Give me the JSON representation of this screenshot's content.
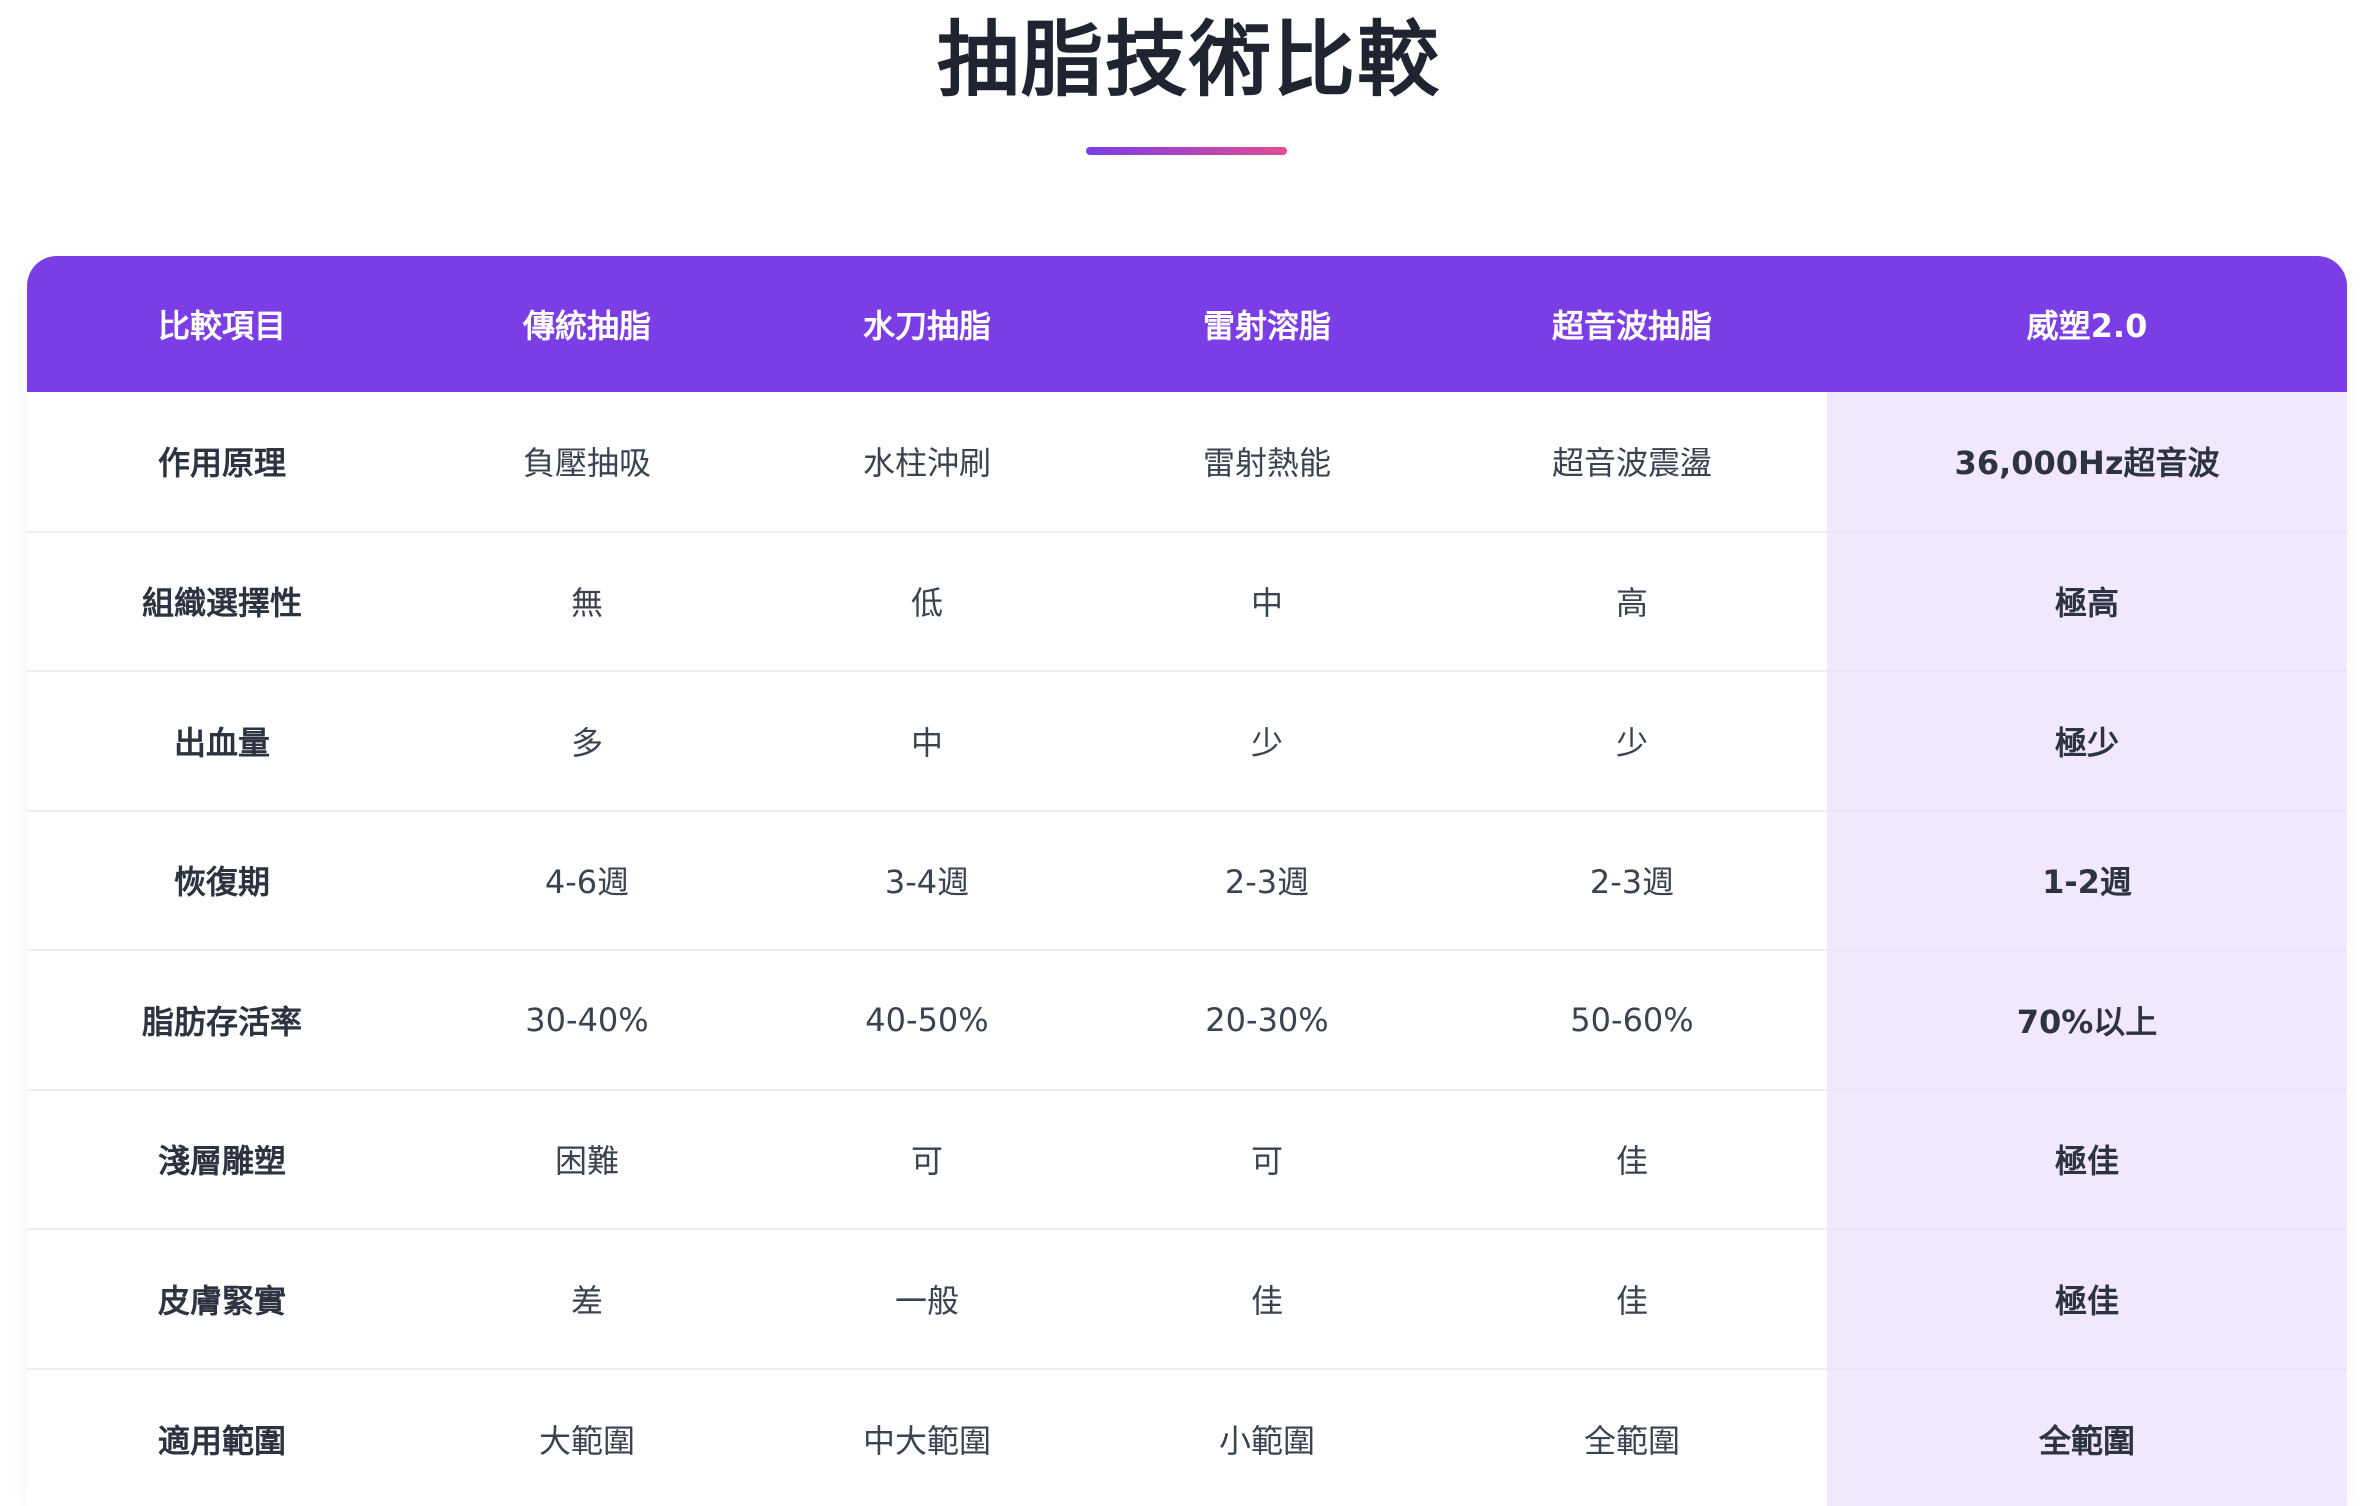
{
  "title": "抽脂技術比較",
  "colors": {
    "header_bg": "#7a3de6",
    "highlight_bg": "#f1e8fd",
    "underline_from": "#7a3de6",
    "underline_to": "#e04d92"
  },
  "table": {
    "headers": [
      "比較項目",
      "傳統抽脂",
      "水刀抽脂",
      "雷射溶脂",
      "超音波抽脂",
      "威塑2.0"
    ],
    "rows": [
      [
        "作用原理",
        "負壓抽吸",
        "水柱沖刷",
        "雷射熱能",
        "超音波震盪",
        "36,000Hz超音波"
      ],
      [
        "組織選擇性",
        "無",
        "低",
        "中",
        "高",
        "極高"
      ],
      [
        "出血量",
        "多",
        "中",
        "少",
        "少",
        "極少"
      ],
      [
        "恢復期",
        "4-6週",
        "3-4週",
        "2-3週",
        "2-3週",
        "1-2週"
      ],
      [
        "脂肪存活率",
        "30-40%",
        "40-50%",
        "20-30%",
        "50-60%",
        "70%以上"
      ],
      [
        "淺層雕塑",
        "困難",
        "可",
        "可",
        "佳",
        "極佳"
      ],
      [
        "皮膚緊實",
        "差",
        "一般",
        "佳",
        "佳",
        "極佳"
      ],
      [
        "適用範圍",
        "大範圍",
        "中大範圍",
        "小範圍",
        "全範圍",
        "全範圍"
      ]
    ]
  }
}
